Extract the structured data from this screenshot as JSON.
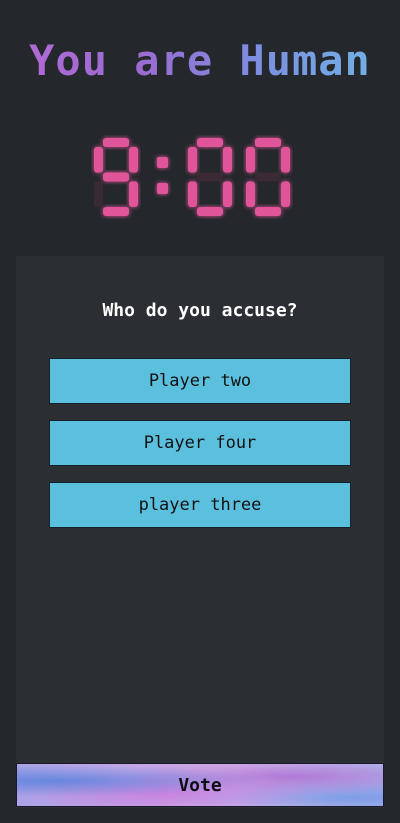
{
  "header": {
    "role_title": "You are Human"
  },
  "timer": {
    "display": "9:00",
    "minutes": "9",
    "seconds": "00",
    "color": "#e0559a"
  },
  "vote_panel": {
    "question": "Who do you accuse?",
    "options": [
      {
        "label": "Player two"
      },
      {
        "label": "Player four"
      },
      {
        "label": "player three"
      }
    ],
    "option_color": "#5bc0de"
  },
  "vote_button": {
    "label": "Vote"
  }
}
